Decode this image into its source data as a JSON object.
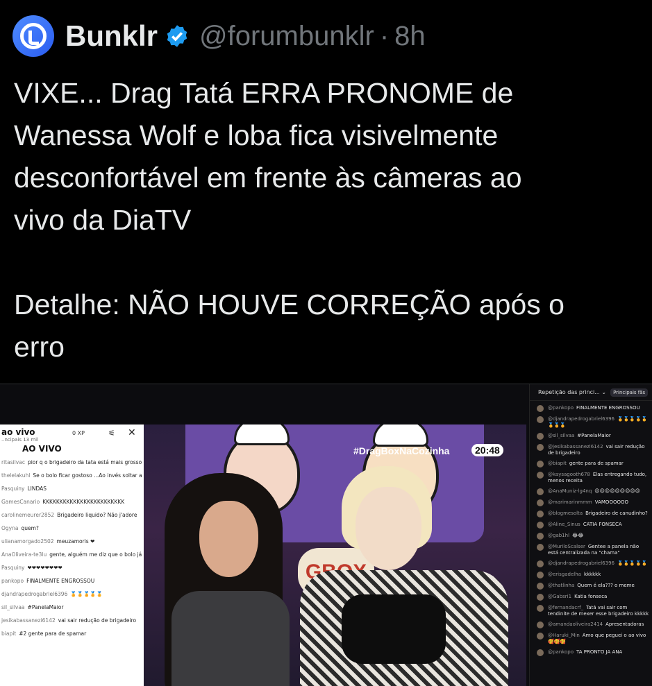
{
  "tweet": {
    "author_name": "Bunklr",
    "handle": "@forumbunklr",
    "separator": "·",
    "time": "8h",
    "text_lines": [
      "VIXE... Drag Tatá ERRA PRONOME de",
      "Wanessa Wolf e loba fica visivelmente",
      "desconfortável em frente às câmeras ao",
      "vivo da DiaTV"
    ],
    "detail_lines": [
      "Detalhe: NÃO HOUVE CORREÇÃO após o",
      "erro"
    ]
  },
  "colors": {
    "background": "#000000",
    "text": "#e7e9ea",
    "muted": "#71767b",
    "verified": "#1d9bf0",
    "avatar": "#2a5cf0"
  },
  "media": {
    "video": {
      "hashtag": "#DragBoxNaCozinha",
      "timer": "20:48",
      "poster_logo": "GBOX"
    },
    "chat_left": {
      "title": "ao vivo",
      "subtitle": "..ncipais  13 mil",
      "xp": "0 XP",
      "live_label": "AO VIVO",
      "messages": [
        {
          "user": "ritasilvac",
          "text": "pior q o brigadeiro da tata está mais grosso kkkkkk"
        },
        {
          "user": "thelelakuhl",
          "text": "Se o bolo ficar gostoso ...Ao invés soltar a franga, soltem UIVOS!!!!!"
        },
        {
          "user": "Pasquiny",
          "text": "LINDAS"
        },
        {
          "user": "GamesCanario",
          "text": "KKKKKKKKKKKKKKKKKKKKKKKK"
        },
        {
          "user": "carolinemeurer2852",
          "text": "Brigadeiro liquido? Não j'adore"
        },
        {
          "user": "Ogyna",
          "text": "quem?"
        },
        {
          "user": "ulianamorgado2502",
          "text": "meuzamoris ❤"
        },
        {
          "user": "AnaOliveira-te3lu",
          "text": "gente, alguém me diz que o bolo já pronto e assado, só pra confeitar"
        },
        {
          "user": "Pasquiny",
          "text": "❤❤❤❤❤❤❤❤"
        },
        {
          "user": "pankopo",
          "text": "FINALMENTE ENGROSSOU"
        },
        {
          "user": "djandrapedrogabriel6396",
          "text": "🏅🏅🏅🏅🏅"
        },
        {
          "user": "sil_silvaa",
          "text": "#PanelaMaior"
        },
        {
          "user": "jesikabassanezi6142",
          "text": "vai sair redução de brigadeiro"
        },
        {
          "user": "biapit",
          "text": "#2  gente para de spamar"
        }
      ]
    },
    "chat_right": {
      "header": "Repetição das princi...",
      "chip": "Principais fãs",
      "messages": [
        {
          "user": "@pankopo",
          "text": "FINALMENTE ENGROSSOU"
        },
        {
          "user": "@djandrapedrogabriel6396",
          "text": "🏅🏅🏅🏅🏅🏅🏅🏅"
        },
        {
          "user": "@sil_silvaa",
          "text": "#PanelaMaior"
        },
        {
          "user": "@jesikabassanezi6142",
          "text": "vai sair redução de brigadeiro"
        },
        {
          "user": "@biapit",
          "text": "gente para de spamar"
        },
        {
          "user": "@kaysagooth678",
          "text": "Elas entregando tudo, menos receita"
        },
        {
          "user": "@AnaMuniz-lg4nq",
          "text": "😍😍😍😍😍😍😍😍😍"
        },
        {
          "user": "@marimarinmmm",
          "text": "VAMOOOOOO"
        },
        {
          "user": "@blogmesolta",
          "text": "Brigadeiro de canudinho?"
        },
        {
          "user": "@Aline_Sinus",
          "text": "CÁTIA FONSECA"
        },
        {
          "user": "@gab1hl",
          "text": "😂😂"
        },
        {
          "user": "@MuriloScalser",
          "text": "Gentee a panela não está centralizada na \"chama\""
        },
        {
          "user": "@djandrapedrogabriel6396",
          "text": "🏅🏅🏅🏅🏅"
        },
        {
          "user": "@erisgadelha",
          "text": "kkkkkk"
        },
        {
          "user": "@thatlinha",
          "text": "Quem é ela??? o meme"
        },
        {
          "user": "@Gabsri1",
          "text": "Katia fonseca"
        },
        {
          "user": "@fernandacrf_",
          "text": "Tatá vai sair com tendinite de mexer esse brigadeiro kkkkk"
        },
        {
          "user": "@amandaoliveira2414",
          "text": "Apresentadoras"
        },
        {
          "user": "@Haruki_Min",
          "text": "Amo que peguei o ao vivo 🥰🥰🥰"
        },
        {
          "user": "@pankopo",
          "text": "TA PRONTO JA ANA"
        }
      ]
    }
  }
}
